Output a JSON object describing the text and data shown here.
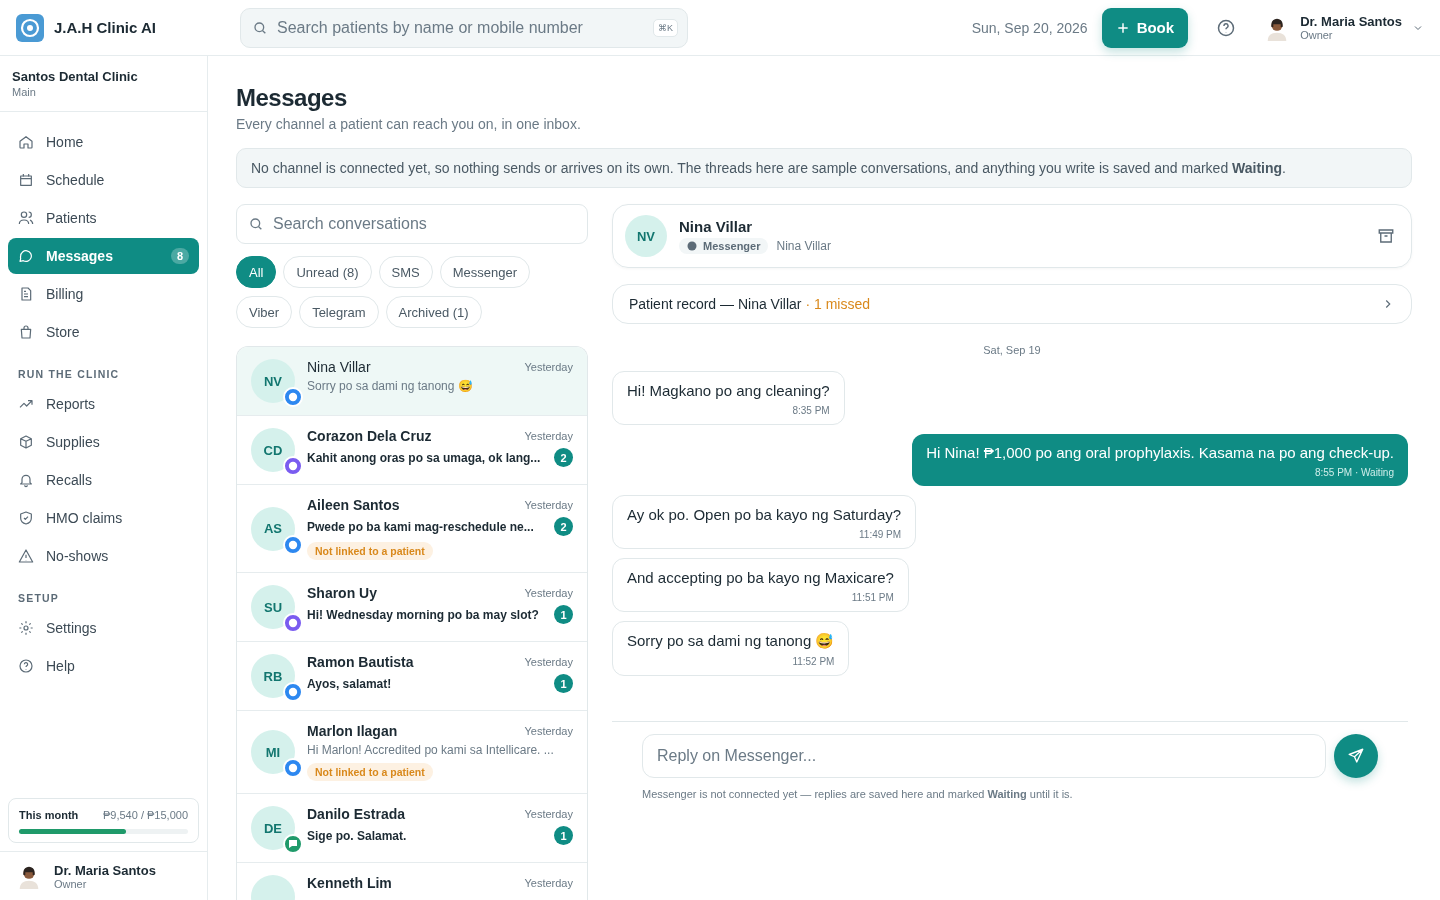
{
  "brand": {
    "name": "J.A.H Clinic AI"
  },
  "search": {
    "placeholder": "Search patients by name or mobile number",
    "shortcut": "⌘K"
  },
  "topbar": {
    "date": "Sun, Sep 20, 2026",
    "book_button": "Book",
    "user": {
      "name": "Dr. Maria Santos",
      "role": "Owner"
    }
  },
  "sidebar": {
    "clinic": "Santos Dental Clinic",
    "branch": "Main",
    "sections": [
      {
        "items": [
          {
            "label": "Home",
            "selected": false
          },
          {
            "label": "Schedule",
            "selected": false
          },
          {
            "label": "Patients",
            "selected": false
          },
          {
            "label": "Messages",
            "selected": true,
            "badge": "8"
          },
          {
            "label": "Billing",
            "selected": false
          },
          {
            "label": "Store",
            "selected": false
          }
        ]
      },
      {
        "heading": "RUN THE CLINIC",
        "items": [
          {
            "label": "Reports",
            "selected": false
          },
          {
            "label": "Supplies",
            "selected": false
          },
          {
            "label": "Recalls",
            "selected": false
          },
          {
            "label": "HMO claims",
            "selected": false
          },
          {
            "label": "No-shows",
            "selected": false
          }
        ]
      },
      {
        "heading": "SETUP",
        "items": [
          {
            "label": "Settings",
            "selected": false
          },
          {
            "label": "Help",
            "selected": false
          }
        ]
      }
    ],
    "usage": {
      "label": "This month",
      "value": "₱9,540 / ₱15,000",
      "level": 0.636
    },
    "user": {
      "name": "Dr. Maria Santos",
      "role": "Owner"
    }
  },
  "page": {
    "title": "Messages",
    "subtitle": "Every channel a patient can reach you on, in one inbox.",
    "notice": "No channel is connected yet, so nothing sends or arrives on its own. The threads here are sample conversations, and anything you write is saved and marked **Waiting**."
  },
  "conversation_search": {
    "placeholder": "Search conversations"
  },
  "filters": [
    {
      "label": "All",
      "selected": true
    },
    {
      "label": "Unread (8)",
      "selected": false
    },
    {
      "label": "SMS",
      "selected": false
    },
    {
      "label": "Messenger",
      "selected": false
    },
    {
      "label": "Viber",
      "selected": false
    },
    {
      "label": "Telegram",
      "selected": false
    },
    {
      "label": "Archived (1)",
      "selected": false
    }
  ],
  "conversations": [
    {
      "initials": "NV",
      "kind": "messenger",
      "name": "Nina Villar",
      "time": "Yesterday",
      "preview": "Sorry po sa dami ng tanong 😅",
      "unread": false,
      "selected": true
    },
    {
      "initials": "CD",
      "kind": "viber",
      "name": "Corazon Dela Cruz",
      "time": "Yesterday",
      "preview": "Kahit anong oras po sa umaga, ok lang...",
      "unread": true,
      "count": "2",
      "selected": false
    },
    {
      "initials": "AS",
      "kind": "messenger",
      "name": "Aileen Santos",
      "time": "Yesterday",
      "preview": "Pwede po ba kami mag-reschedule ne...",
      "unread": true,
      "count": "2",
      "tag": "Not linked to a patient",
      "selected": false
    },
    {
      "initials": "SU",
      "kind": "viber",
      "name": "Sharon Uy",
      "time": "Yesterday",
      "preview": "Hi! Wednesday morning po ba may slot?",
      "unread": true,
      "count": "1",
      "selected": false
    },
    {
      "initials": "RB",
      "kind": "messenger",
      "name": "Ramon Bautista",
      "time": "Yesterday",
      "preview": "Ayos, salamat!",
      "unread": true,
      "count": "1",
      "selected": false
    },
    {
      "initials": "MI",
      "kind": "messenger",
      "name": "Marlon Ilagan",
      "time": "Yesterday",
      "preview": "Hi Marlon! Accredited po kami sa Intellicare. ...",
      "unread": false,
      "tag": "Not linked to a patient",
      "selected": false
    },
    {
      "initials": "DE",
      "kind": "sms",
      "name": "Danilo Estrada",
      "time": "Yesterday",
      "preview": "Sige po. Salamat.",
      "unread": true,
      "count": "1",
      "selected": false
    },
    {
      "name": "Kenneth Lim",
      "time": "Yesterday",
      "selected": false
    }
  ],
  "thread": {
    "initials": "NV",
    "name": "Nina Villar",
    "channel": "Messenger",
    "handle": "Nina Villar",
    "record": {
      "text": "Patient record — Nina Villar",
      "missed": "· 1 missed"
    },
    "date": "Sat, Sep 19",
    "messages": [
      {
        "kind": "in",
        "text": "Hi! Magkano po ang cleaning?",
        "time": "8:35 PM"
      },
      {
        "kind": "out",
        "text": "Hi Nina! ₱1,000 po ang oral prophylaxis. Kasama na po ang check-up.",
        "time": "8:55 PM · Waiting"
      },
      {
        "kind": "in",
        "text": "Ay ok po. Open po ba kayo ng Saturday?",
        "time": "11:49 PM"
      },
      {
        "kind": "in",
        "text": "And accepting po ba kayo ng Maxicare?",
        "time": "11:51 PM"
      },
      {
        "kind": "in",
        "text": "Sorry po sa dami ng tanong 😅",
        "time": "11:52 PM"
      }
    ],
    "reply_placeholder": "Reply on Messenger...",
    "footnote": "Messenger is not connected yet — replies are saved here and marked **Waiting** until it is."
  }
}
